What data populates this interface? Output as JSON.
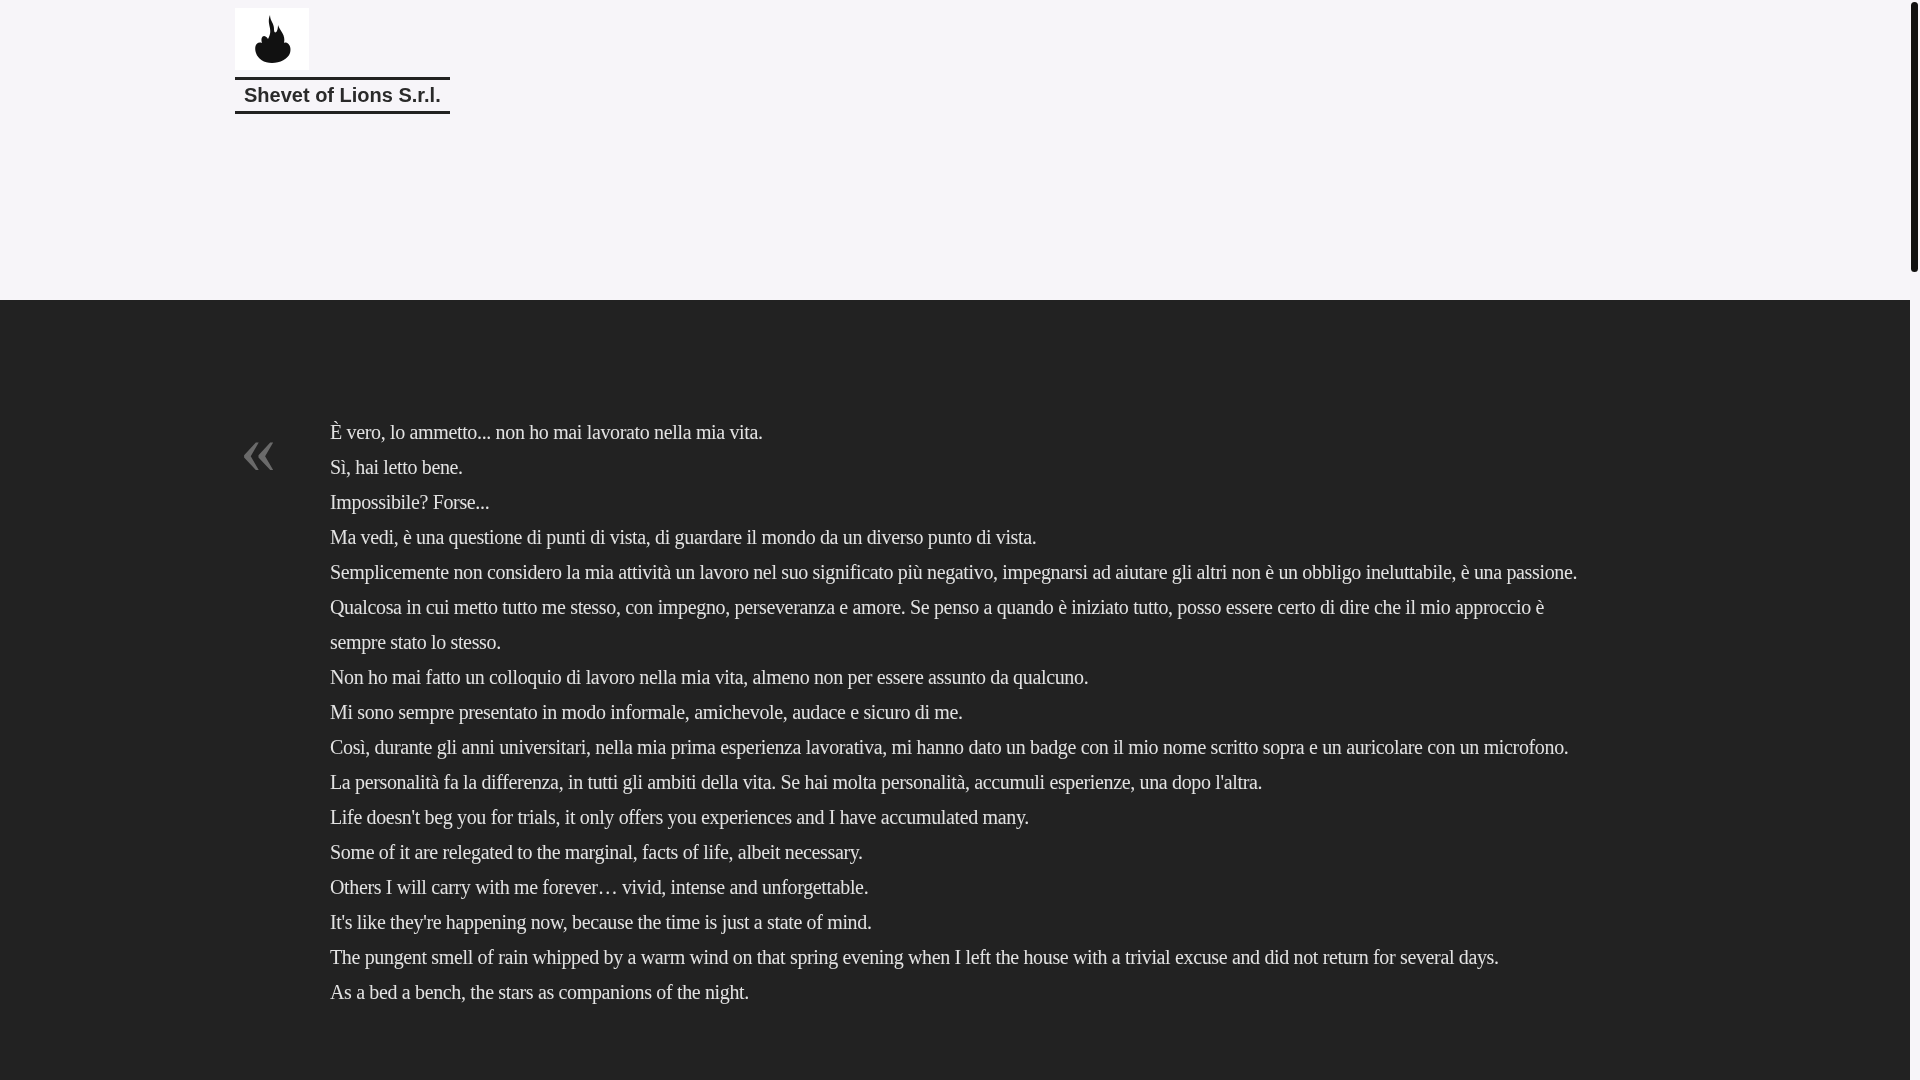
{
  "header": {
    "company": "Shevet of Lions S.r.l."
  },
  "quote": {
    "mark": "«",
    "lines": [
      "È vero, lo ammetto... non ho mai lavorato nella mia vita.",
      "Sì, hai letto bene.",
      "Impossibile? Forse...",
      "Ma vedi, è una questione di punti di vista, di guardare il mondo da un diverso punto di vista.",
      "Semplicemente non considero la mia attività un lavoro nel suo significato più negativo, impegnarsi ad aiutare gli altri non è un obbligo ineluttabile, è una passione.",
      "Qualcosa in cui metto tutto me stesso, con impegno, perseveranza e amore. Se penso a quando è iniziato tutto, posso essere certo di dire che il mio approccio è sempre stato lo stesso.",
      "Non ho mai fatto un colloquio di lavoro nella mia vita, almeno non per essere assunto da qualcuno.",
      "Mi sono sempre presentato in modo informale, amichevole, audace e sicuro di me.",
      "Così, durante gli anni universitari, nella mia prima esperienza lavorativa, mi hanno dato un badge con il mio nome scritto sopra e un auricolare con un microfono.",
      "La personalità fa la differenza, in tutti gli ambiti della vita. Se hai molta personalità, accumuli esperienze, una dopo l'altra.",
      "Life doesn't beg you for trials, it only offers you experiences and I have accumulated many.",
      "Some of it are relegated to the marginal, facts of life, albeit necessary.",
      "Others I will carry with me forever… vivid, intense and unforgettable.",
      "It's like they're happening now, because the time is just a state of mind.",
      "The pungent smell of rain whipped by a warm wind on that spring evening when I left the house with a trivial excuse and did not return for several days.",
      "As a bed a bench, the stars as companions of the night."
    ]
  }
}
